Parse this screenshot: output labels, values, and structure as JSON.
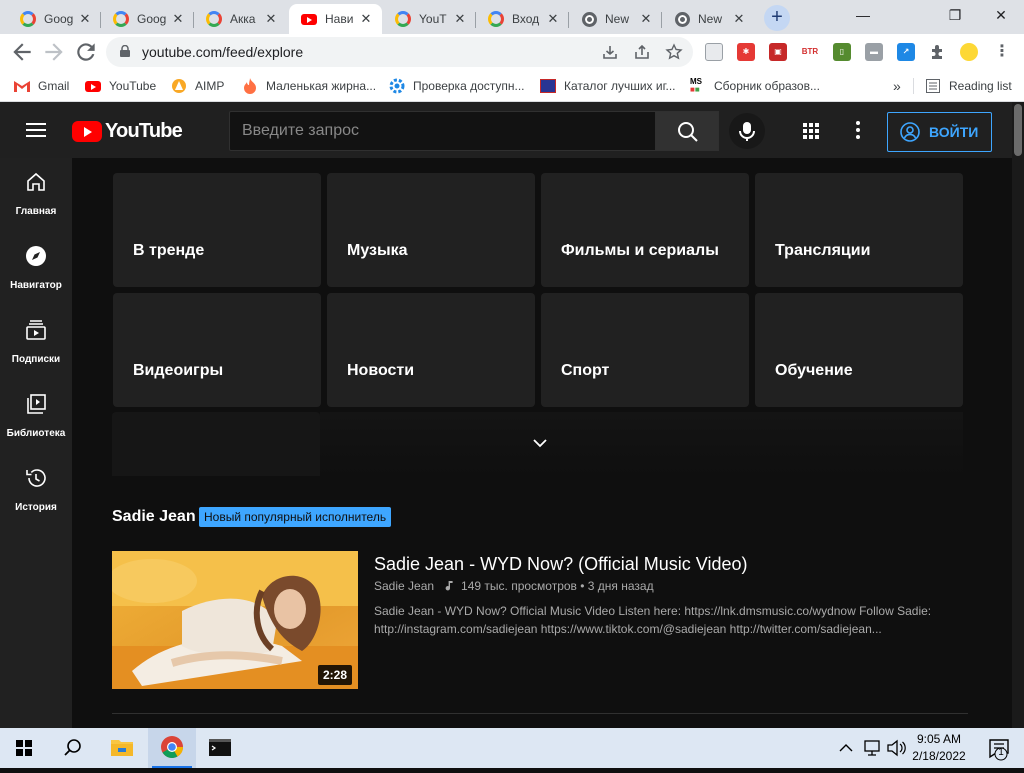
{
  "browser": {
    "tabs": [
      {
        "title": "Goog",
        "favicon": "google-icon",
        "active": false
      },
      {
        "title": "Goog",
        "favicon": "google-icon",
        "active": false
      },
      {
        "title": "Акка",
        "favicon": "google-icon",
        "active": false
      },
      {
        "title": "Нави",
        "favicon": "youtube-icon",
        "active": true
      },
      {
        "title": "YouT",
        "favicon": "google-icon",
        "active": false
      },
      {
        "title": "Вход",
        "favicon": "google-icon",
        "active": false
      },
      {
        "title": "New",
        "favicon": "chrome-icon",
        "active": false
      },
      {
        "title": "New",
        "favicon": "chrome-icon",
        "active": false
      }
    ],
    "new_tab_symbol": "+",
    "url": "youtube.com/feed/explore",
    "bookmarks": [
      {
        "label": "Gmail",
        "icon": "gmail-icon"
      },
      {
        "label": "YouTube",
        "icon": "youtube-icon"
      },
      {
        "label": "AIMP",
        "icon": "aimp-icon"
      },
      {
        "label": "Маленькая жирна...",
        "icon": "fire-icon"
      },
      {
        "label": "Проверка доступн...",
        "icon": "gear-icon"
      },
      {
        "label": "Каталог лучших иг...",
        "icon": "catalog-icon"
      },
      {
        "label": "Сборник образов...",
        "icon": "ms-icon"
      }
    ],
    "bookmarks_overflow": "»",
    "reading_list": "Reading list",
    "extension_label": "BTR"
  },
  "youtube": {
    "logo_text": "YouTube",
    "search_placeholder": "Введите запрос",
    "signin_label": "ВОЙТИ",
    "guide": [
      {
        "label": "Главная",
        "icon": "home-icon"
      },
      {
        "label": "Навигатор",
        "icon": "compass-icon"
      },
      {
        "label": "Подписки",
        "icon": "subscriptions-icon"
      },
      {
        "label": "Библиотека",
        "icon": "library-icon"
      },
      {
        "label": "История",
        "icon": "history-icon"
      }
    ],
    "destinations": [
      "В тренде",
      "Музыка",
      "Фильмы и сериалы",
      "Трансляции",
      "Видеоигры",
      "Новости",
      "Спорт",
      "Обучение"
    ],
    "shelf": {
      "title": "Sadie Jean",
      "badge": "Новый популярный исполнитель"
    },
    "video": {
      "title": "Sadie Jean - WYD Now? (Official Music Video)",
      "channel": "Sadie Jean",
      "stats": "149 тыс. просмотров • 3 дня назад",
      "description": "Sadie Jean - WYD Now? Official Music Video Listen here: https://lnk.dmsmusic.co/wydnow Follow Sadie: http://instagram.com/sadiejean https://www.tiktok.com/@sadiejean http://twitter.com/sadiejean...",
      "duration": "2:28"
    }
  },
  "taskbar": {
    "time": "9:05 AM",
    "date": "2/18/2022",
    "notification_count": "1"
  },
  "colors": {
    "yt_red": "#ff0000",
    "yt_blue": "#3ea6ff",
    "page_bg": "#0f0f0f",
    "card_bg": "#212121",
    "masthead_bg": "#202020"
  }
}
